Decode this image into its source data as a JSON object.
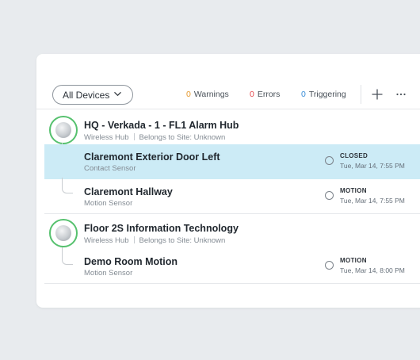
{
  "toolbar": {
    "filter_label": "All Devices",
    "warnings_count": "0",
    "warnings_label": "Warnings",
    "errors_count": "0",
    "errors_label": "Errors",
    "triggering_count": "0",
    "triggering_label": "Triggering"
  },
  "colors": {
    "warning": "#e69a2e",
    "error": "#e5484d",
    "triggering": "#3b8fd8",
    "hub_ring": "#56c16e",
    "selected_row": "#ccebf6"
  },
  "devices": [
    {
      "kind": "hub",
      "name": "HQ - Verkada - 1 - FL1 Alarm Hub",
      "type": "Wireless Hub",
      "site": "Belongs to Site: Unknown"
    },
    {
      "kind": "sensor",
      "name": "Claremont Exterior Door Left",
      "type": "Contact Sensor",
      "status": "CLOSED",
      "time": "Tue, Mar 14, 7:55 PM",
      "selected": true
    },
    {
      "kind": "sensor",
      "name": "Claremont Hallway",
      "type": "Motion Sensor",
      "status": "MOTION",
      "time": "Tue, Mar 14, 7:55 PM"
    },
    {
      "kind": "hub",
      "name": "Floor 2S Information Technology",
      "type": "Wireless Hub",
      "site": "Belongs to Site: Unknown"
    },
    {
      "kind": "sensor",
      "name": "Demo Room Motion",
      "type": "Motion Sensor",
      "status": "MOTION",
      "time": "Tue, Mar 14, 8:00 PM"
    }
  ]
}
